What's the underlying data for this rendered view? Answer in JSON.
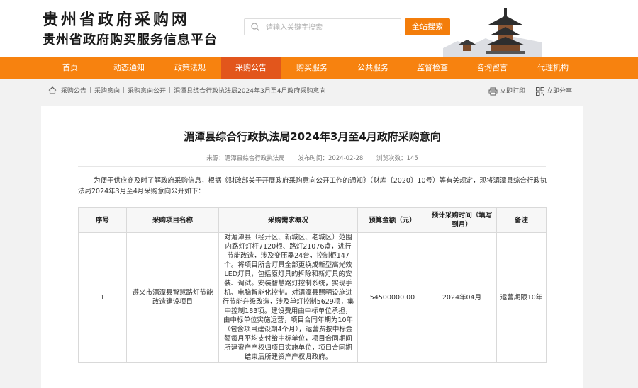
{
  "header": {
    "site_title": "贵州省政府采购网",
    "site_subtitle": "贵州省政府购买服务信息平台",
    "search_placeholder": "请输入关键字搜索",
    "search_button": "全站搜索"
  },
  "nav": {
    "items": [
      "首页",
      "动态通知",
      "政策法规",
      "采购公告",
      "购买服务",
      "公共服务",
      "监督检查",
      "咨询留言",
      "代理机构"
    ],
    "active_index": 3
  },
  "breadcrumb": [
    "采购公告",
    "采购意向",
    "采购意向公开",
    "湄潭县综合行政执法局2024年3月至4月政府采购意向"
  ],
  "tools": {
    "print": "立即打印",
    "share": "立即分享"
  },
  "article": {
    "title": "湄潭县综合行政执法局2024年3月至4月政府采购意向",
    "source": "来源：湄潭县综合行政执法局",
    "publish_time": "发布时间：2024-02-28",
    "views": "浏览次数：145",
    "intro": "为便于供应商及时了解政府采购信息，根据《财政部关于开展政府采购意向公开工作的通知》（财库〔2020〕10号）等有关规定，现将湄潭县综合行政执法局2024年3月至4月采购意向公开如下："
  },
  "table": {
    "headers": [
      "序号",
      "采购项目名称",
      "采购需求概况",
      "预算金额（元）",
      "预计采购时间（填写到月）",
      "备注"
    ],
    "rows": [
      {
        "index": "1",
        "name": "遵义市湄潭县智慧路灯节能改造建设项目",
        "overview": "对湄潭县（经开区、新城区、老城区）范围内路灯灯杆7120根、路灯21076盏，进行节能改造，涉及变压器24台，控制柜147个。将项目所含灯具全部更换成新型高光效LED灯具，包括原灯具的拆除和新灯具的安装、调试。安装智慧路灯控制系统，实现手机、电脑智能化控制。对湄潭县照明设施进行节能升级改造，涉及单灯控制5629项，集中控制183项。建设费用由中标单位承担，由中标单位实施运营，项目合同年期为10年（包含项目建设期4个月），运营费按中标金额每月平均支付给中标单位，项目合同期间所建资产产权归项目实施单位，项目合同期结束后所建资产产权归政府。",
        "budget": "54500000.00",
        "time": "2024年04月",
        "remark": "运营期限10年"
      }
    ]
  },
  "colors": {
    "nav": "#f7820f",
    "nav_active": "#e2561c",
    "search_button": "#f37d0b",
    "page_bg": "#f2f2f2"
  },
  "icons": [
    "search-icon",
    "home-icon",
    "print-icon",
    "qr-code-icon",
    "pagoda-logo"
  ]
}
